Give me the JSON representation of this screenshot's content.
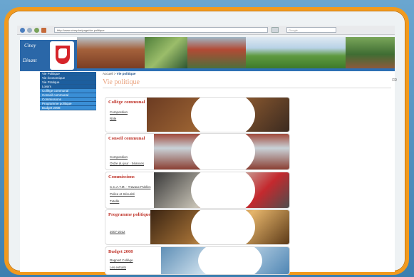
{
  "browser": {
    "address": "http://www.ciney.be/page/vie-politique",
    "search_placeholder": "Google"
  },
  "header": {
    "logo_line1": "Ciney",
    "logo_line2": "Dinant"
  },
  "nav": {
    "items": [
      {
        "label": "Vie Politique"
      },
      {
        "label": "Vie économique"
      },
      {
        "label": "Vie Pratique"
      },
      {
        "label": "Loisirs"
      },
      {
        "label": "Collège communal"
      },
      {
        "label": "Conseil communal"
      },
      {
        "label": "Commissions"
      },
      {
        "label": "Programme politique"
      },
      {
        "label": "Budget 2008"
      }
    ]
  },
  "main": {
    "breadcrumb_home": "Accueil",
    "breadcrumb_sep": " > ",
    "breadcrumb_current": "Vie politique",
    "title": "Vie politique",
    "top_right": "FR"
  },
  "cards": [
    {
      "title": "Collège communal",
      "links": [
        "Composition",
        "Rôle"
      ]
    },
    {
      "title": "Conseil communal",
      "links": [
        "Composition",
        "Ordre du jour · Séances"
      ]
    },
    {
      "title": "Commissions",
      "links": [
        "C.C.A.T.M. · Travaux Publics",
        "Police et Sécurité",
        "Tutelle"
      ]
    },
    {
      "title": "Programme politique",
      "links": [
        "2007-2012"
      ]
    },
    {
      "title": "Budget 2008",
      "links": [
        "Rapport Collège",
        "Les extraits"
      ]
    }
  ]
}
